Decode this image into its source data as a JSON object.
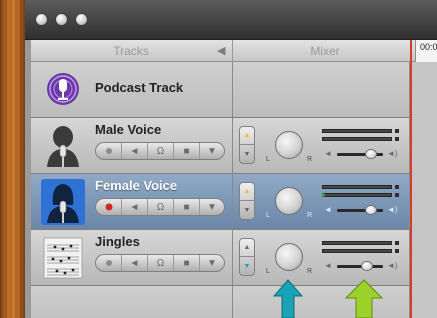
{
  "window": {
    "controls": [
      "close-button",
      "minimize-button",
      "zoom-button"
    ]
  },
  "header": {
    "tracks_label": "Tracks",
    "mixer_label": "Mixer",
    "ruler_label": "00:0",
    "collapse_icon": "triangle-left-icon"
  },
  "tracks": [
    {
      "name": "Podcast Track",
      "icon": "podcast-microphone-icon",
      "selected": false,
      "record_enabled": false
    },
    {
      "name": "Male Voice",
      "icon": "male-voice-microphone-icon",
      "selected": false,
      "record_enabled": false,
      "volume": 0.73
    },
    {
      "name": "Female Voice",
      "icon": "female-voice-microphone-icon",
      "selected": true,
      "record_enabled": true,
      "volume": 0.73
    },
    {
      "name": "Jingles",
      "icon": "sheet-music-icon",
      "selected": false,
      "record_enabled": false,
      "volume": 0.65
    }
  ],
  "track_controls": {
    "record": "record-icon",
    "mute": "speaker-icon",
    "solo": "headphones-icon",
    "lock": "lock-icon",
    "menu": "chevron-down-icon"
  },
  "mixer": {
    "pan_left_label": "L",
    "pan_right_label": "R",
    "volume_low_icon": "speaker-low-icon",
    "volume_high_icon": "speaker-high-icon"
  },
  "annotations": {
    "arrow_1": {
      "color": "#18a3b9",
      "icon": "up-arrow-icon"
    },
    "arrow_2": {
      "color": "#9bd12a",
      "icon": "up-arrow-icon"
    }
  },
  "colors": {
    "selected_row": "#7a96b8",
    "playhead": "#d63a2a",
    "record_active": "#d3261e",
    "meter_green": "#2fb52c",
    "pan_up_yellow": "#e8c21c",
    "pan_down_cyan": "#18a3b9"
  }
}
